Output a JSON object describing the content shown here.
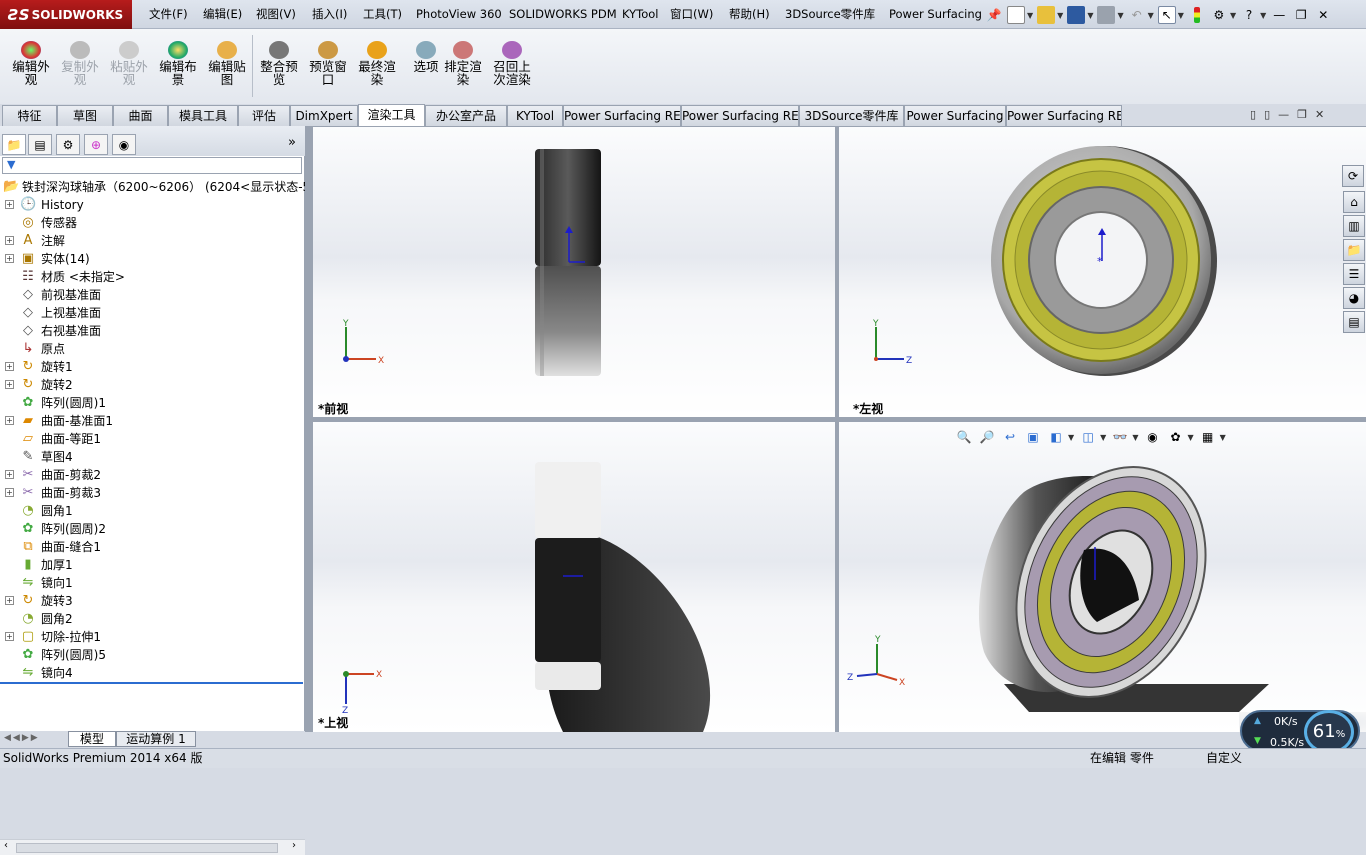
{
  "menubar": {
    "logo": "SOLIDWORKS",
    "items": [
      "文件(F)",
      "编辑(E)",
      "视图(V)",
      "插入(I)",
      "工具(T)",
      "PhotoView 360",
      "SOLIDWORKS PDM",
      "KYTool",
      "窗口(W)",
      "帮助(H)",
      "3DSource零件库",
      "Power Surfacing"
    ]
  },
  "cmd": {
    "buttons": [
      {
        "label": "编辑外观",
        "enabled": true
      },
      {
        "label": "复制外观",
        "enabled": false
      },
      {
        "label": "粘贴外观",
        "enabled": false
      },
      {
        "label": "编辑布景",
        "enabled": true
      },
      {
        "label": "编辑贴图",
        "enabled": true
      },
      {
        "label": "整合预览",
        "enabled": true
      },
      {
        "label": "预览窗口",
        "enabled": true
      },
      {
        "label": "最终渲染",
        "enabled": true
      },
      {
        "label": "选项",
        "enabled": true
      },
      {
        "label": "排定渲染",
        "enabled": true
      },
      {
        "label": "召回上次渲染",
        "enabled": true
      }
    ]
  },
  "tabs": [
    "特征",
    "草图",
    "曲面",
    "模具工具",
    "评估",
    "DimXpert",
    "渲染工具",
    "办公室产品",
    "KYTool",
    "Power Surfacing RE",
    "Power Surfacing RE",
    "3DSource零件库",
    "Power Surfacing",
    "Power Surfacing RE"
  ],
  "active_tab": "渲染工具",
  "tree": {
    "root": "铁封深沟球轴承（6200~6206）  (6204<显示状态-5",
    "items": [
      {
        "label": "History",
        "icon": "history-icon",
        "expand": true
      },
      {
        "label": "传感器",
        "icon": "sensor-icon",
        "expand": false
      },
      {
        "label": "注解",
        "icon": "annotation-icon",
        "expand": true
      },
      {
        "label": "实体(14)",
        "icon": "solid-bodies-icon",
        "expand": true
      },
      {
        "label": "材质 <未指定>",
        "icon": "material-icon",
        "expand": false
      },
      {
        "label": "前视基准面",
        "icon": "plane-icon",
        "expand": false
      },
      {
        "label": "上视基准面",
        "icon": "plane-icon",
        "expand": false
      },
      {
        "label": "右视基准面",
        "icon": "plane-icon",
        "expand": false
      },
      {
        "label": "原点",
        "icon": "origin-icon",
        "expand": false
      },
      {
        "label": "旋转1",
        "icon": "revolve-icon",
        "expand": true
      },
      {
        "label": "旋转2",
        "icon": "revolve-icon",
        "expand": true
      },
      {
        "label": "阵列(圆周)1",
        "icon": "circular-pattern-icon",
        "expand": false
      },
      {
        "label": "曲面-基准面1",
        "icon": "planar-surface-icon",
        "expand": true
      },
      {
        "label": "曲面-等距1",
        "icon": "offset-surface-icon",
        "expand": false
      },
      {
        "label": "草图4",
        "icon": "sketch-icon",
        "expand": false
      },
      {
        "label": "曲面-剪裁2",
        "icon": "trim-surface-icon",
        "expand": true
      },
      {
        "label": "曲面-剪裁3",
        "icon": "trim-surface-icon",
        "expand": true
      },
      {
        "label": "圆角1",
        "icon": "fillet-icon",
        "expand": false
      },
      {
        "label": "阵列(圆周)2",
        "icon": "circular-pattern-icon",
        "expand": false
      },
      {
        "label": "曲面-缝合1",
        "icon": "knit-surface-icon",
        "expand": false
      },
      {
        "label": "加厚1",
        "icon": "thicken-icon",
        "expand": false
      },
      {
        "label": "镜向1",
        "icon": "mirror-icon",
        "expand": false
      },
      {
        "label": "旋转3",
        "icon": "revolve-icon",
        "expand": true
      },
      {
        "label": "圆角2",
        "icon": "fillet-icon",
        "expand": false
      },
      {
        "label": "切除-拉伸1",
        "icon": "extruded-cut-icon",
        "expand": true
      },
      {
        "label": "阵列(圆周)5",
        "icon": "circular-pattern-icon",
        "expand": false
      },
      {
        "label": "镜向4",
        "icon": "mirror-icon",
        "expand": false
      }
    ]
  },
  "bottom_tabs": [
    "模型",
    "运动算例 1"
  ],
  "viewports": {
    "front": "*前视",
    "left": "*左视",
    "top": "*上视"
  },
  "status": {
    "product": "SolidWorks Premium 2014 x64 版",
    "mode": "在编辑 零件",
    "units": "自定义"
  },
  "net": {
    "up": "0K/s",
    "down": "0.5K/s",
    "percent": "61"
  },
  "percent_sign": "%",
  "axis_labels": {
    "x": "X",
    "y": "Y",
    "z": "Z"
  },
  "colors": {
    "accent": "#2b4f8f",
    "yellow_ring": "#b5b436",
    "purple_ring": "#a79bb0"
  }
}
